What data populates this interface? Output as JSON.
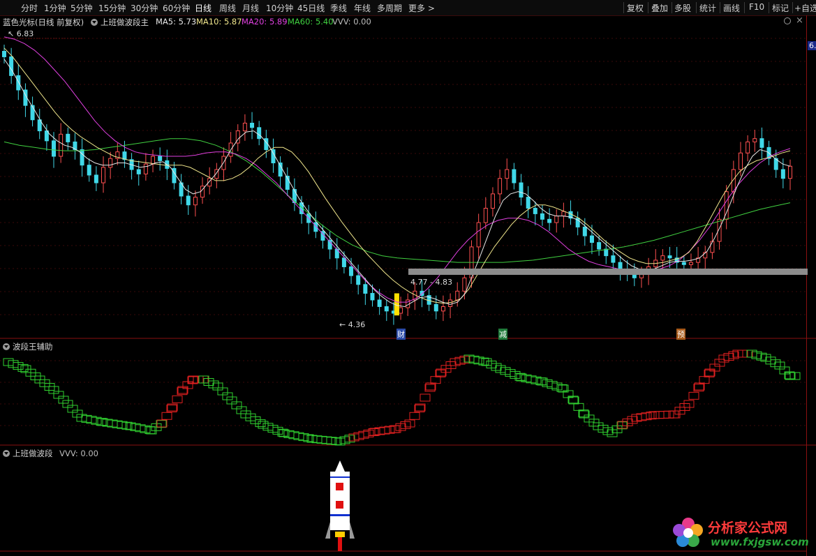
{
  "toolbar": {
    "periods": [
      "分时",
      "1分钟",
      "5分钟",
      "15分钟",
      "30分钟",
      "60分钟",
      "日线",
      "周线",
      "月线",
      "10分钟",
      "45日线",
      "季线",
      "年线",
      "多周期",
      "更多 >"
    ],
    "active_index": 6,
    "right_items": [
      "复权",
      "叠加",
      "多股",
      "统计",
      "画线",
      "F10",
      "标记",
      "+自选"
    ]
  },
  "main_legend": {
    "symbol": "蓝色光标(日线 前复权)",
    "indicator": "上班做波段主",
    "ma5": "MA5: 5.73",
    "ma10": "MA10: 5.87",
    "ma20": "MA20: 5.89",
    "ma60": "MA60: 5.40",
    "vvv": "VVV: 0.00",
    "top_right_icons": [
      "settings-icon",
      "close-icon"
    ]
  },
  "colors": {
    "ma5": "#e8e8e8",
    "ma10": "#f0e68c",
    "ma20": "#e040e0",
    "ma60": "#40d040",
    "up": "#ff5050",
    "down": "#40d8e8",
    "wave_up": "#e02020",
    "wave_down": "#30d030"
  },
  "annotations": {
    "high_label": "6.83",
    "low_label": "4.36",
    "range_label": "4.77 - 4.83",
    "axis_right_value": "6.",
    "marker_cai": "财",
    "marker_jian": "减",
    "marker_yu": "预"
  },
  "panel2": {
    "title": "波段王辅助"
  },
  "panel3": {
    "title": "上班做波段",
    "vvv": "VVV: 0.00"
  },
  "watermark": {
    "name": "分析家公式网",
    "url": "www.fxjgsw.com"
  },
  "chart_data": {
    "type": "candlestick",
    "close": [
      6.72,
      6.55,
      6.42,
      6.28,
      6.15,
      6.05,
      5.96,
      5.82,
      6.02,
      5.95,
      5.88,
      5.74,
      5.65,
      5.58,
      5.72,
      5.8,
      5.86,
      5.79,
      5.7,
      5.66,
      5.75,
      5.82,
      5.78,
      5.71,
      5.58,
      5.46,
      5.38,
      5.45,
      5.55,
      5.62,
      5.7,
      5.82,
      5.94,
      6.05,
      6.12,
      6.08,
      5.98,
      5.88,
      5.76,
      5.64,
      5.52,
      5.4,
      5.3,
      5.22,
      5.14,
      5.06,
      4.98,
      4.9,
      4.82,
      4.74,
      4.66,
      4.58,
      4.52,
      4.46,
      4.42,
      4.4,
      4.45,
      4.52,
      4.6,
      4.56,
      4.48,
      4.42,
      4.46,
      4.52,
      4.6,
      4.72,
      5.0,
      5.22,
      5.35,
      5.48,
      5.62,
      5.7,
      5.58,
      5.45,
      5.35,
      5.3,
      5.25,
      5.22,
      5.28,
      5.32,
      5.26,
      5.18,
      5.1,
      5.04,
      4.98,
      4.92,
      4.86,
      4.8,
      4.75,
      4.72,
      4.76,
      4.82,
      4.88,
      4.92,
      4.9,
      4.86,
      4.84,
      4.86,
      4.9,
      4.95,
      5.05,
      5.25,
      5.5,
      5.7,
      5.85,
      5.95,
      5.98,
      5.9,
      5.8,
      5.7,
      5.62,
      5.73
    ],
    "ma5": [
      6.7,
      6.6,
      6.48,
      6.35,
      6.24,
      6.12,
      6.02,
      5.96,
      5.92,
      5.9,
      5.86,
      5.8,
      5.76,
      5.74,
      5.74,
      5.76,
      5.76,
      5.74,
      5.72,
      5.73,
      5.76,
      5.77,
      5.72,
      5.62,
      5.52,
      5.48,
      5.5,
      5.58,
      5.66,
      5.76,
      5.88,
      5.98,
      6.04,
      6.05,
      6.0,
      5.92,
      5.8,
      5.68,
      5.56,
      5.44,
      5.34,
      5.25,
      5.17,
      5.09,
      5.01,
      4.93,
      4.85,
      4.77,
      4.69,
      4.61,
      4.55,
      4.5,
      4.47,
      4.46,
      4.5,
      4.54,
      4.55,
      4.53,
      4.5,
      4.48,
      4.5,
      4.58,
      4.75,
      4.92,
      5.1,
      5.28,
      5.42,
      5.48,
      5.5,
      5.48,
      5.42,
      5.35,
      5.3,
      5.28,
      5.28,
      5.27,
      5.24,
      5.18,
      5.12,
      5.06,
      5.0,
      4.94,
      4.88,
      4.83,
      4.8,
      4.79,
      4.8,
      4.83,
      4.86,
      4.87,
      4.87,
      4.88,
      4.9,
      4.96,
      5.08,
      5.22,
      5.38,
      5.55,
      5.7,
      5.82,
      5.88,
      5.86,
      5.8,
      5.75,
      5.73
    ],
    "ma10": [
      6.8,
      6.72,
      6.62,
      6.52,
      6.42,
      6.32,
      6.22,
      6.13,
      6.06,
      6.0,
      5.95,
      5.9,
      5.86,
      5.82,
      5.8,
      5.78,
      5.77,
      5.76,
      5.75,
      5.74,
      5.74,
      5.74,
      5.72,
      5.68,
      5.64,
      5.6,
      5.6,
      5.62,
      5.66,
      5.72,
      5.8,
      5.86,
      5.9,
      5.9,
      5.86,
      5.78,
      5.68,
      5.56,
      5.44,
      5.33,
      5.22,
      5.12,
      5.02,
      4.93,
      4.85,
      4.77,
      4.7,
      4.64,
      4.59,
      4.55,
      4.52,
      4.5,
      4.49,
      4.5,
      4.53,
      4.62,
      4.75,
      4.88,
      5.0,
      5.1,
      5.2,
      5.28,
      5.34,
      5.38,
      5.38,
      5.36,
      5.33,
      5.3,
      5.26,
      5.2,
      5.13,
      5.06,
      5.0,
      4.95,
      4.9,
      4.87,
      4.85,
      4.85,
      4.86,
      4.88,
      4.9,
      4.95,
      5.05,
      5.18,
      5.32,
      5.46,
      5.58,
      5.68,
      5.74,
      5.78,
      5.8,
      5.82,
      5.85,
      5.87
    ],
    "ma20": [
      6.9,
      6.88,
      6.84,
      6.78,
      6.7,
      6.6,
      6.5,
      6.38,
      6.26,
      6.14,
      6.04,
      5.96,
      5.9,
      5.86,
      5.84,
      5.83,
      5.82,
      5.82,
      5.82,
      5.83,
      5.85,
      5.86,
      5.86,
      5.84,
      5.8,
      5.74,
      5.66,
      5.58,
      5.48,
      5.38,
      5.28,
      5.18,
      5.08,
      4.98,
      4.88,
      4.78,
      4.68,
      4.6,
      4.54,
      4.5,
      4.5,
      4.54,
      4.62,
      4.72,
      4.84,
      4.96,
      5.06,
      5.14,
      5.2,
      5.24,
      5.26,
      5.26,
      5.24,
      5.2,
      5.14,
      5.06,
      4.98,
      4.92,
      4.87,
      4.84,
      4.82,
      4.8,
      4.79,
      4.78,
      4.79,
      4.8,
      4.83,
      4.88,
      4.96,
      5.06,
      5.18,
      5.32,
      5.46,
      5.58,
      5.68,
      5.76,
      5.82,
      5.86,
      5.89
    ],
    "ma60": [
      5.95,
      5.92,
      5.9,
      5.88,
      5.87,
      5.87,
      5.88,
      5.9,
      5.92,
      5.94,
      5.96,
      5.98,
      5.98,
      5.96,
      5.92,
      5.86,
      5.78,
      5.68,
      5.56,
      5.44,
      5.32,
      5.2,
      5.1,
      5.02,
      4.96,
      4.92,
      4.9,
      4.89,
      4.88,
      4.87,
      4.86,
      4.86,
      4.86,
      4.86,
      4.87,
      4.88,
      4.9,
      4.92,
      4.94,
      4.96,
      4.98,
      5.0,
      5.03,
      5.06,
      5.1,
      5.14,
      5.18,
      5.22,
      5.26,
      5.3,
      5.34,
      5.37,
      5.4
    ]
  }
}
